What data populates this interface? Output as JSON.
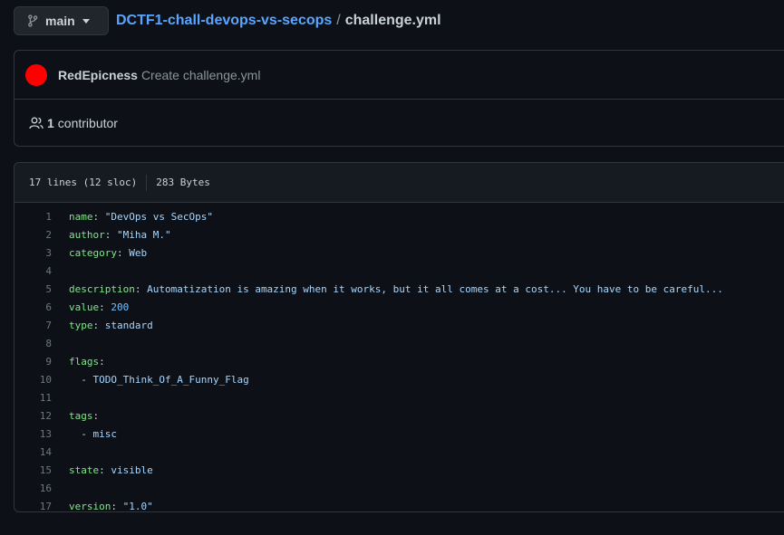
{
  "branch": {
    "label": "main"
  },
  "breadcrumb": {
    "repo": "DCTF1-chall-devops-vs-secops",
    "separator": "/",
    "file": "challenge.yml"
  },
  "commit": {
    "author": "RedEpicness",
    "message": "Create challenge.yml",
    "avatar_color": "#ff0000"
  },
  "contributors": {
    "count": "1",
    "label": "contributor"
  },
  "file_info": {
    "lines": "17 lines (12 sloc)",
    "size": "283 Bytes"
  },
  "code_lines": [
    {
      "num": "1",
      "key": "name",
      "sep": ": ",
      "value": "\"DevOps vs SecOps\"",
      "vclass": "val"
    },
    {
      "num": "2",
      "key": "author",
      "sep": ": ",
      "value": "\"Miha M.\"",
      "vclass": "val"
    },
    {
      "num": "3",
      "key": "category",
      "sep": ": ",
      "value": "Web",
      "vclass": "val"
    },
    {
      "num": "4",
      "key": "",
      "sep": "",
      "value": "",
      "vclass": "val"
    },
    {
      "num": "5",
      "key": "description",
      "sep": ": ",
      "value": "Automatization is amazing when it works, but it all comes at a cost... You have to be careful...",
      "vclass": "val"
    },
    {
      "num": "6",
      "key": "value",
      "sep": ": ",
      "value": "200",
      "vclass": "num"
    },
    {
      "num": "7",
      "key": "type",
      "sep": ": ",
      "value": "standard",
      "vclass": "val"
    },
    {
      "num": "8",
      "key": "",
      "sep": "",
      "value": "",
      "vclass": "val"
    },
    {
      "num": "9",
      "key": "flags",
      "sep": ":",
      "value": "",
      "vclass": "val"
    },
    {
      "num": "10",
      "key": "",
      "sep": "  - ",
      "value": "TODO_Think_Of_A_Funny_Flag",
      "vclass": "val"
    },
    {
      "num": "11",
      "key": "",
      "sep": "",
      "value": "",
      "vclass": "val"
    },
    {
      "num": "12",
      "key": "tags",
      "sep": ":",
      "value": "",
      "vclass": "val"
    },
    {
      "num": "13",
      "key": "",
      "sep": "  - ",
      "value": "misc",
      "vclass": "val"
    },
    {
      "num": "14",
      "key": "",
      "sep": "",
      "value": "",
      "vclass": "val"
    },
    {
      "num": "15",
      "key": "state",
      "sep": ": ",
      "value": "visible",
      "vclass": "val"
    },
    {
      "num": "16",
      "key": "",
      "sep": "",
      "value": "",
      "vclass": "val"
    },
    {
      "num": "17",
      "key": "version",
      "sep": ": ",
      "value": "\"1.0\"",
      "vclass": "val"
    }
  ],
  "colors": {
    "background": "#0d1117",
    "border": "#30363d",
    "link": "#58a6ff",
    "key": "#7ee787",
    "string": "#a5d6ff",
    "number": "#79c0ff"
  }
}
